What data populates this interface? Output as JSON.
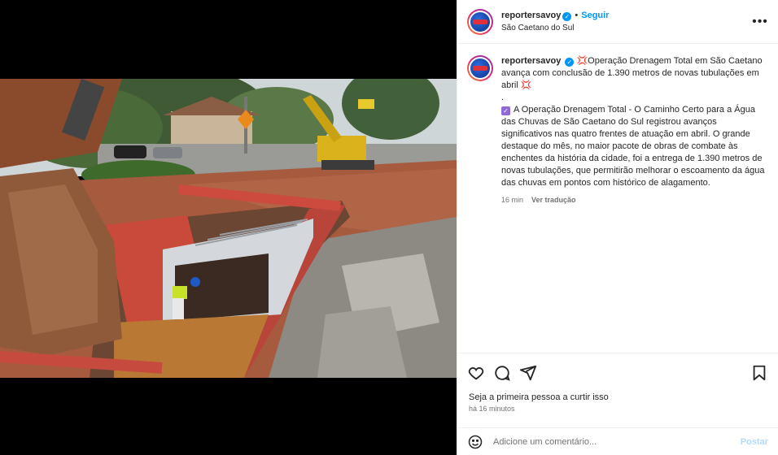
{
  "post": {
    "username": "reportersavoy",
    "verified_mark": "✓",
    "separator": "•",
    "follow_label": "Seguir",
    "location": "São Caetano do Sul",
    "more_icon": "more-horizontal-icon"
  },
  "caption": {
    "username": "reportersavoy",
    "verified_mark": "✓",
    "burst_emoji": "💢",
    "headline": "Operação Drenagem Total em São Caetano avança com conclusão de 1.390 metros de novas tubulações em abril",
    "dot_line": ".",
    "check_emoji": "✓",
    "body": "A Operação Drenagem Total - O Caminho Certo para a Água das Chuvas de São Caetano do Sul registrou avanços significativos nas quatro frentes de atuação em abril. O grande destaque do mês, no maior pacote de obras de combate às enchentes da história da cidade, foi a entrega de 1.390 metros de novas tubulações, que permitirão melhorar o escoamento da água das chuvas em pontos com histórico de alagamento.",
    "time": "16 min",
    "translation": "Ver tradução"
  },
  "actions": {
    "like_icon": "heart-icon",
    "comment_icon": "comment-icon",
    "share_icon": "share-icon",
    "save_icon": "bookmark-icon"
  },
  "likes_text": "Seja a primeira pessoa a curtir isso",
  "posted_ago": "há 16 minutos",
  "comment": {
    "placeholder": "Adicione um comentário...",
    "post_label": "Postar",
    "emoji_icon": "smiley-icon"
  },
  "colors": {
    "accent": "#0095f6",
    "muted": "#737373",
    "post_disabled": "#b3dbff"
  }
}
